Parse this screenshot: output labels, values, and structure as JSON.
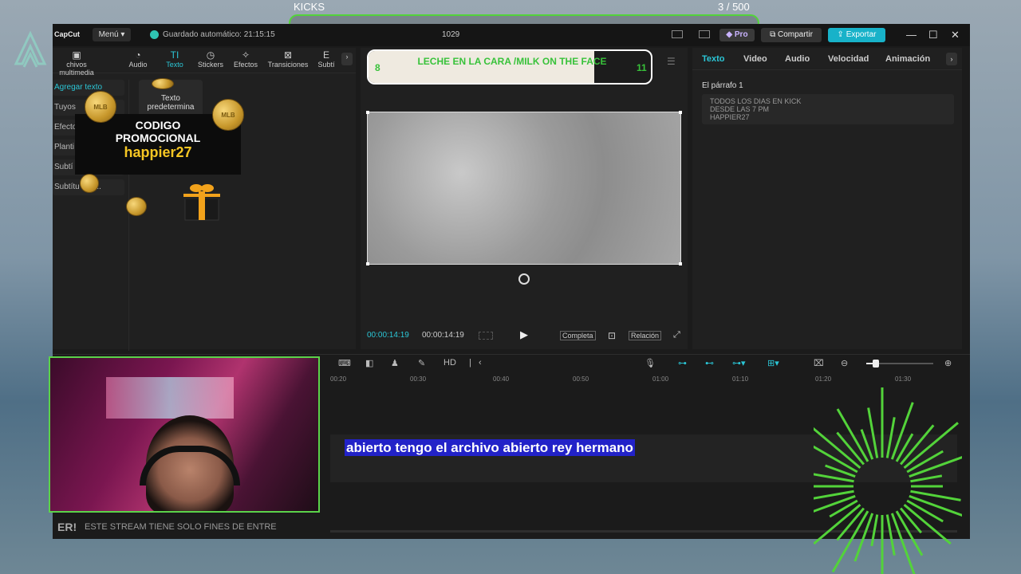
{
  "overlay": {
    "kick_label": "KICKS",
    "kick_count": "3   / 500",
    "promo_line1": "CODIGO",
    "promo_line2": "PROMOCIONAL",
    "promo_code": "happier27",
    "coin_text": "MLB",
    "ticker_er": "ER!",
    "ticker_text": "ESTE STREAM TIENE SOLO FINES DE ENTRE",
    "caption": "abierto tengo el archivo abierto rey hermano",
    "accent_green": "#53d33a"
  },
  "titlebar": {
    "logo": "CapCut",
    "menu": "Menú",
    "autosave": "Guardado automático: 21:15:15",
    "project": "1029",
    "pro": "Pro",
    "share": "Compartir",
    "export": "Exportar",
    "minimize": "—",
    "maximize": "☐",
    "close": "✕"
  },
  "media_tabs": [
    {
      "label": "chivos multimedia",
      "icon": "▣"
    },
    {
      "label": "Audio",
      "icon": "◔"
    },
    {
      "label": "Texto",
      "icon": "TI"
    },
    {
      "label": "Stickers",
      "icon": "◷"
    },
    {
      "label": "Efectos",
      "icon": "✧"
    },
    {
      "label": "Transiciones",
      "icon": "⊠"
    },
    {
      "label": "Subtí",
      "icon": "E"
    },
    {
      "label": "",
      "icon": "›"
    }
  ],
  "side_items": [
    "Agregar texto",
    "Tuyos",
    "Efecto",
    "Planti",
    "Subtí",
    "Subtítu   oca..."
  ],
  "preset_card": "Texto predetermina",
  "player": {
    "progress_start": "8",
    "progress_end": "11",
    "progress_title": "LECHE EN LA CARA /MILK ON THE FACE",
    "progress_fraction": 0.8,
    "time_current": "00:00:14:19",
    "time_total": "00:00:14:19",
    "btn_full": "Completa",
    "btn_ratio": "Relación"
  },
  "inspector": {
    "tabs": [
      "Texto",
      "Video",
      "Audio",
      "Velocidad",
      "Animación"
    ],
    "paragraph_label": "El párrafo 1",
    "paragraph_lines": [
      "TODOS LOS DIAS EN KICK",
      "DESDE LAS 7 PM",
      "HAPPIER27"
    ]
  },
  "timeline": {
    "ruler": [
      "00:20",
      "00:30",
      "00:40",
      "00:50",
      "01:00",
      "01:10",
      "01:20",
      "01:30"
    ],
    "zoom_fraction": 0.1
  }
}
